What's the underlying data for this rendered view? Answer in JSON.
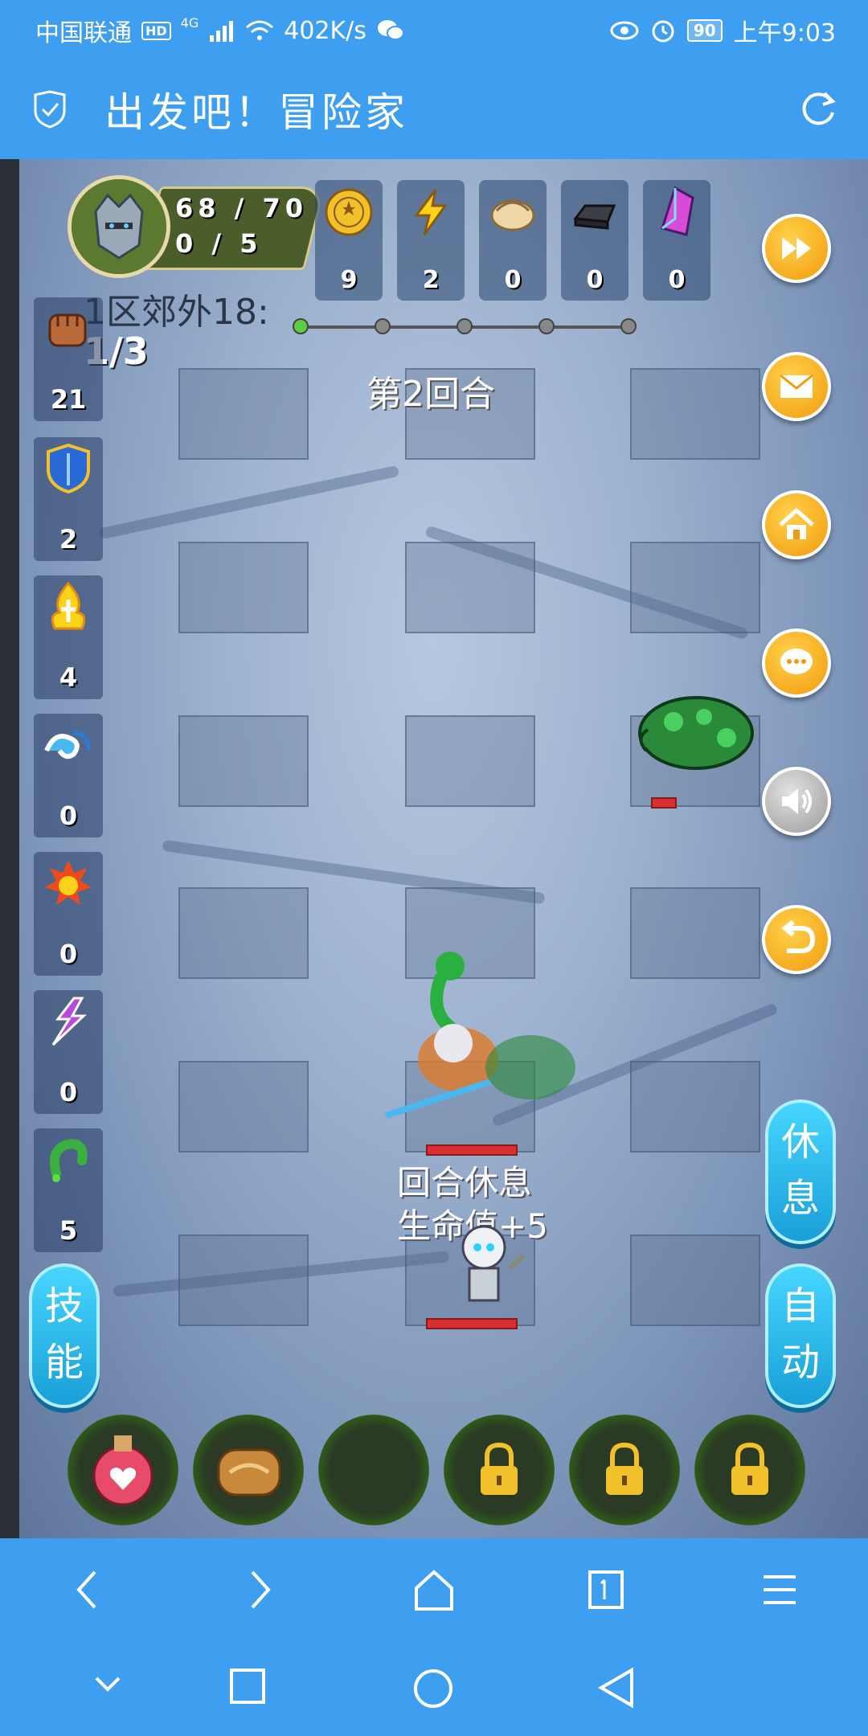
{
  "status_bar": {
    "carrier": "中国联通",
    "hd": "HD",
    "network": "4G",
    "speed": "402K/s",
    "battery": "90",
    "time": "上午9:03"
  },
  "title_bar": {
    "title": "出发吧！冒险家"
  },
  "player": {
    "hp": "68 / 70",
    "mp": "0 / 5"
  },
  "resources": [
    {
      "icon": "gold-coin-icon",
      "value": "9"
    },
    {
      "icon": "lightning-icon",
      "value": "2"
    },
    {
      "icon": "dumpling-icon",
      "value": "0"
    },
    {
      "icon": "iron-ingot-icon",
      "value": "0"
    },
    {
      "icon": "crystal-icon",
      "value": "0"
    }
  ],
  "stage": {
    "name": "1区郊外18:",
    "count": "1/3",
    "round": "第2回合"
  },
  "skills": [
    {
      "icon": "fist-icon",
      "value": "21"
    },
    {
      "icon": "shield-icon",
      "value": "2"
    },
    {
      "icon": "holy-fire-icon",
      "value": "4"
    },
    {
      "icon": "wave-icon",
      "value": "0"
    },
    {
      "icon": "fireball-icon",
      "value": "0"
    },
    {
      "icon": "lightning-bolt-icon",
      "value": "0"
    },
    {
      "icon": "poison-worm-icon",
      "value": "5"
    }
  ],
  "battle_text": {
    "line1": "回合休息",
    "line2": "生命值+5"
  },
  "buttons": {
    "skill": "技能",
    "rest": "休息",
    "auto": "自动"
  },
  "colors": {
    "accent": "#3e9ef0",
    "orange_button": "#f29a0e",
    "pill_button": "#1a9fd8"
  }
}
